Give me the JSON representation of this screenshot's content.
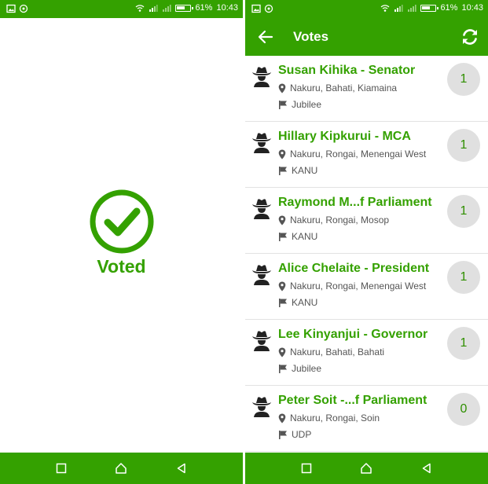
{
  "status_bar": {
    "battery": "61%",
    "time": "10:43"
  },
  "left_screen": {
    "voted_label": "Voted"
  },
  "right_screen": {
    "title": "Votes",
    "votes": [
      {
        "name": "Susan Kihika - Senator",
        "location": "Nakuru, Bahati, Kiamaina",
        "party": "Jubilee",
        "count": "1"
      },
      {
        "name": "Hillary Kipkurui - MCA",
        "location": "Nakuru, Rongai, Menengai West",
        "party": "KANU",
        "count": "1"
      },
      {
        "name": "Raymond M...f Parliament",
        "location": "Nakuru, Rongai, Mosop",
        "party": "KANU",
        "count": "1"
      },
      {
        "name": "Alice Chelaite - President",
        "location": "Nakuru, Rongai, Menengai West",
        "party": "KANU",
        "count": "1"
      },
      {
        "name": "Lee Kinyanjui - Governor",
        "location": "Nakuru, Bahati, Bahati",
        "party": "Jubilee",
        "count": "1"
      },
      {
        "name": "Peter Soit -...f Parliament",
        "location": "Nakuru, Rongai, Soin",
        "party": "UDP",
        "count": "0"
      }
    ]
  },
  "colors": {
    "accent": "#34a100",
    "count_bg": "#e0e0e0"
  },
  "icons": [
    "image-icon",
    "sync-icon",
    "wifi-icon",
    "signal-icon",
    "battery-icon",
    "back-arrow-icon",
    "refresh-icon",
    "cowboy-avatar-icon",
    "location-pin-icon",
    "flag-icon",
    "check-circle-icon",
    "recent-apps-icon",
    "home-icon",
    "back-nav-icon"
  ]
}
